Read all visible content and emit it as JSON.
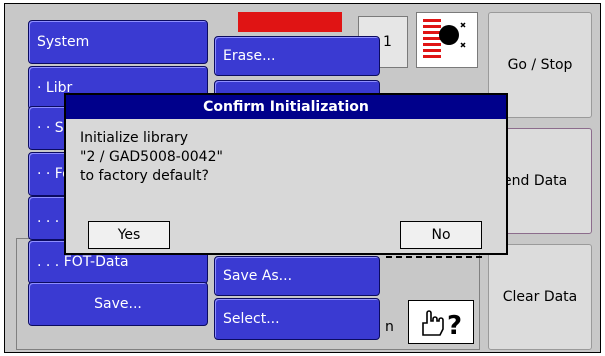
{
  "top": {
    "channel_number": "1",
    "logo_icon": "signal-logo-icon"
  },
  "right_buttons": {
    "go_stop": "Go / Stop",
    "send_data": "end Data",
    "clear_data": "Clear Data"
  },
  "menu": {
    "left": [
      "System",
      "· Libr",
      "· · Se",
      "· · Fe",
      ". . . F",
      ". . . FOT-Data",
      "Save..."
    ],
    "right": [
      "Erase...",
      "Save As...",
      "Select..."
    ]
  },
  "background_fragment": "n",
  "help_icon": "hand-question-icon",
  "dialog": {
    "title": "Confirm Initialization",
    "message": [
      "Initialize library",
      "\"2 / GAD5008-0042\"",
      "to factory default?"
    ],
    "yes_label": "Yes",
    "no_label": "No"
  },
  "colors": {
    "menu_blue": "#3a3ad2",
    "dialog_title": "#00008b",
    "alert_red": "#e01414"
  }
}
